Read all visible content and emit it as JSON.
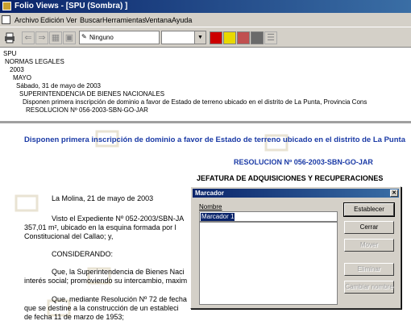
{
  "window": {
    "title": "Folio Views - [SPU (Sombra) ]"
  },
  "menu": [
    "Archivo",
    "Edición",
    "Ver",
    "Buscar",
    "Herramientas",
    "Ventana",
    "Ayuda"
  ],
  "toolbar": {
    "style_combo_value": "Ninguno"
  },
  "tree": {
    "lines": [
      "SPU",
      "NORMAS LEGALES",
      "2003",
      "MAYO",
      "Sábado, 31 de mayo de 2003",
      "SUPERINTENDENCIA DE BIENES NACIONALES",
      "Disponen primera inscripción de dominio a favor de Estado de terreno ubicado en el distrito de La Punta, Provincia Cons",
      "RESOLUCION Nº 056-2003-SBN-GO-JAR"
    ]
  },
  "document": {
    "heading": "Disponen primera inscripción de dominio a favor de Estado de terreno ubicado en el distrito de La Punta",
    "resolution": "RESOLUCION Nº 056-2003-SBN-GO-JAR",
    "office": "JEFATURA DE ADQUISICIONES Y RECUPERACIONES",
    "date_line": "La Molina, 21 de mayo de 2003",
    "para1_a": "Visto el Expediente Nº 052-2003/SBN-JA",
    "para1_b": "357,01 m², ubicado en la esquina formada por l",
    "para1_c": "Constitucional del Callao; y,",
    "considerando": "CONSIDERANDO:",
    "para2_a": "Que, la Superintendencia de Bienes Naci",
    "para2_b": "interés social; promoviendo su intercambio, maxim",
    "para3_a": "Que, mediante Resolución Nº 72 de fecha",
    "para3_b": "que se destine a la construcción de un estableci",
    "para3_c": "de fecha 11 de marzo de 1953;"
  },
  "dialog": {
    "title": "Marcador",
    "name_label": "Nombre",
    "name_value": "Marcador 1",
    "buttons": {
      "establecer": "Establecer",
      "cerrar": "Cerrar",
      "mover": "Mover",
      "eliminar": "Eliminar",
      "cambiar_nombre": "Cambiar nombre"
    }
  }
}
